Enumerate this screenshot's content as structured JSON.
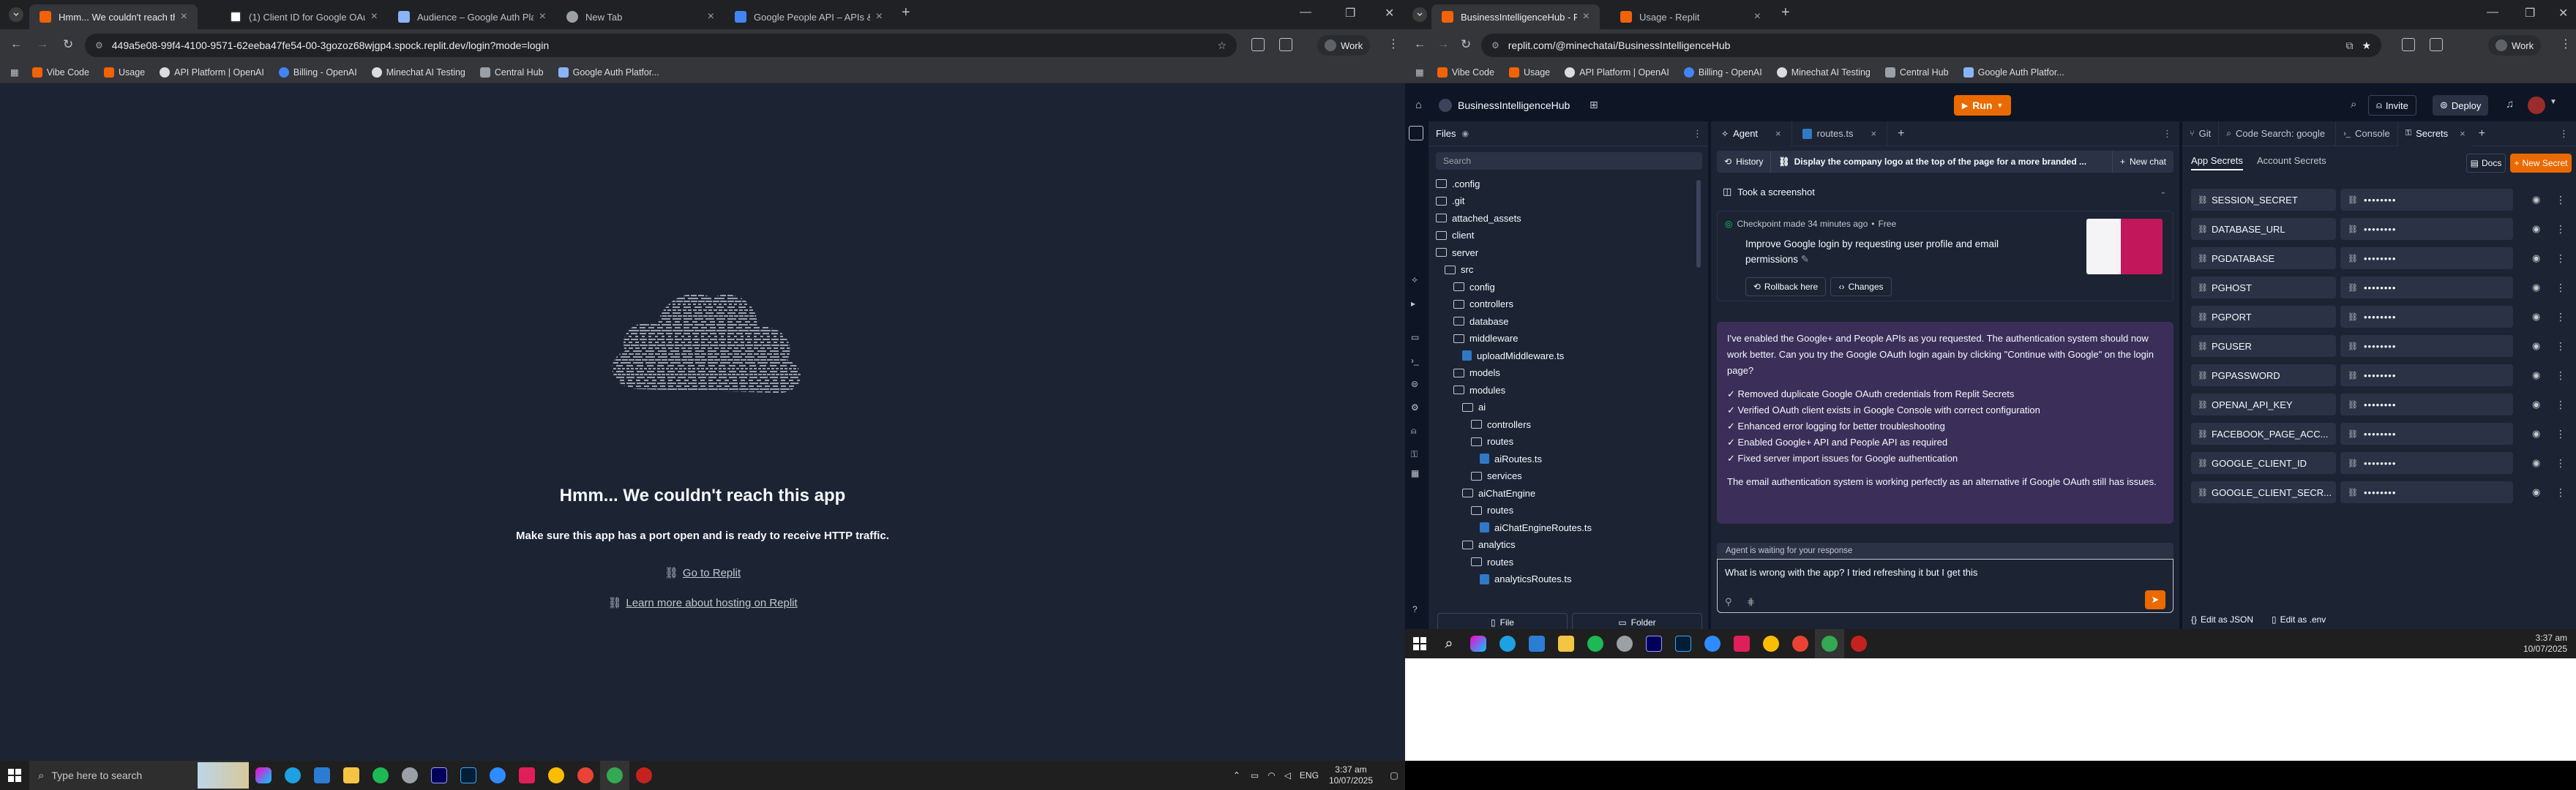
{
  "left": {
    "tabs": [
      {
        "title": "Hmm... We couldn't reach this a",
        "active": true
      },
      {
        "title": "(1) Client ID for Google OAuth"
      },
      {
        "title": "Audience – Google Auth Platfo"
      },
      {
        "title": "New Tab"
      },
      {
        "title": "Google People API – APIs & Se"
      }
    ],
    "url": "449a5e08-99f4-4100-9571-62eeba47fe54-00-3gozoz68wjgp4.spock.replit.dev/login?mode=login",
    "profile": "Work",
    "bookmarks": [
      "Vibe Code",
      "Usage",
      "API Platform | OpenAI",
      "Billing - OpenAI",
      "Minechat AI Testing",
      "Central Hub",
      "Google Auth Platfor..."
    ],
    "error": {
      "title": "Hmm... We couldn't reach this app",
      "subtitle": "Make sure this app has a port open and is ready to receive HTTP traffic.",
      "link1": "Go to Replit",
      "link2": "Learn more about hosting on Replit"
    }
  },
  "taskbar_left": {
    "search_placeholder": "Type here to search",
    "lang": "ENG",
    "time": "3:37 am",
    "date": "10/07/2025"
  },
  "right": {
    "tabs": [
      {
        "title": "BusinessIntelligenceHub - Repl",
        "active": true
      },
      {
        "title": "Usage - Replit"
      }
    ],
    "url": "replit.com/@minechatai/BusinessIntelligenceHub",
    "profile": "Work",
    "bookmarks": [
      "Vibe Code",
      "Usage",
      "API Platform | OpenAI",
      "Billing - OpenAI",
      "Minechat AI Testing",
      "Central Hub",
      "Google Auth Platfor..."
    ],
    "project": "BusinessIntelligenceHub",
    "run_label": "Run",
    "invite_label": "Invite",
    "deploy_label": "Deploy",
    "files": {
      "header": "Files",
      "search_placeholder": "Search",
      "items": [
        {
          "name": ".config",
          "type": "folder",
          "depth": 0
        },
        {
          "name": ".git",
          "type": "folder",
          "depth": 0
        },
        {
          "name": "attached_assets",
          "type": "folder",
          "depth": 0
        },
        {
          "name": "client",
          "type": "folder",
          "depth": 0
        },
        {
          "name": "server",
          "type": "folder",
          "depth": 0
        },
        {
          "name": "src",
          "type": "folder",
          "depth": 1
        },
        {
          "name": "config",
          "type": "folder",
          "depth": 2
        },
        {
          "name": "controllers",
          "type": "folder",
          "depth": 2
        },
        {
          "name": "database",
          "type": "folder",
          "depth": 2
        },
        {
          "name": "middleware",
          "type": "folder",
          "depth": 2
        },
        {
          "name": "uploadMiddleware.ts",
          "type": "file",
          "depth": 3
        },
        {
          "name": "models",
          "type": "folder",
          "depth": 2
        },
        {
          "name": "modules",
          "type": "folder",
          "depth": 2
        },
        {
          "name": "ai",
          "type": "folder",
          "depth": 3
        },
        {
          "name": "controllers",
          "type": "folder",
          "depth": 4
        },
        {
          "name": "routes",
          "type": "folder",
          "depth": 4
        },
        {
          "name": "aiRoutes.ts",
          "type": "file",
          "depth": 5
        },
        {
          "name": "services",
          "type": "folder",
          "depth": 4
        },
        {
          "name": "aiChatEngine",
          "type": "folder",
          "depth": 3
        },
        {
          "name": "routes",
          "type": "folder",
          "depth": 4
        },
        {
          "name": "aiChatEngineRoutes.ts",
          "type": "file",
          "depth": 5
        },
        {
          "name": "analytics",
          "type": "folder",
          "depth": 3
        },
        {
          "name": "routes",
          "type": "folder",
          "depth": 4
        },
        {
          "name": "analyticsRoutes.ts",
          "type": "file",
          "depth": 5
        }
      ],
      "file_btn": "File",
      "folder_btn": "Folder"
    },
    "agent": {
      "tab_agent": "Agent",
      "tab_routes": "routes.ts",
      "history": "History",
      "banner": "Display the company logo at the top of the page for a more branded ...",
      "new_chat": "New chat",
      "screenshot": "Took a screenshot",
      "checkpoint": "Checkpoint made 34 minutes ago",
      "free": "Free",
      "checkpoint_desc": "Improve Google login by requesting user profile and email permissions",
      "rollback": "Rollback here",
      "changes": "Changes",
      "message": "I've enabled the Google+ and People APIs as you requested. The authentication system should now work better. Can you try the Google OAuth login again by clicking \"Continue with Google\" on the login page?",
      "checks": [
        "Removed duplicate Google OAuth credentials from Replit Secrets",
        "Verified OAuth client exists in Google Console with correct configuration",
        "Enhanced error logging for better troubleshooting",
        "Enabled Google+ API and People API as required",
        "Fixed server import issues for Google authentication"
      ],
      "footer": "The email authentication system is working perfectly as an alternative if Google OAuth still has issues.",
      "waiting": "Agent is waiting for your response",
      "input": "What is wrong with the app? I tried refreshing it but I get this"
    },
    "secrets": {
      "tabs": [
        "Git",
        "Code Search: google",
        "Console",
        "Secrets"
      ],
      "app_secrets": "App Secrets",
      "account_secrets": "Account Secrets",
      "docs": "Docs",
      "new_secret": "New Secret",
      "keys": [
        "SESSION_SECRET",
        "DATABASE_URL",
        "PGDATABASE",
        "PGHOST",
        "PGPORT",
        "PGUSER",
        "PGPASSWORD",
        "OPENAI_API_KEY",
        "FACEBOOK_PAGE_ACC...",
        "GOOGLE_CLIENT_ID",
        "GOOGLE_CLIENT_SECR..."
      ],
      "masked": "••••••••",
      "edit_json": "Edit as JSON",
      "edit_env": "Edit as .env"
    }
  },
  "taskbar_right": {
    "time": "3:37 am",
    "date": "10/07/2025"
  },
  "colors": {
    "accent_orange": "#ff7b00",
    "replit_bg": "#0e1525",
    "pane_bg": "#1c2333",
    "link_blue": "#a7c6ff"
  }
}
